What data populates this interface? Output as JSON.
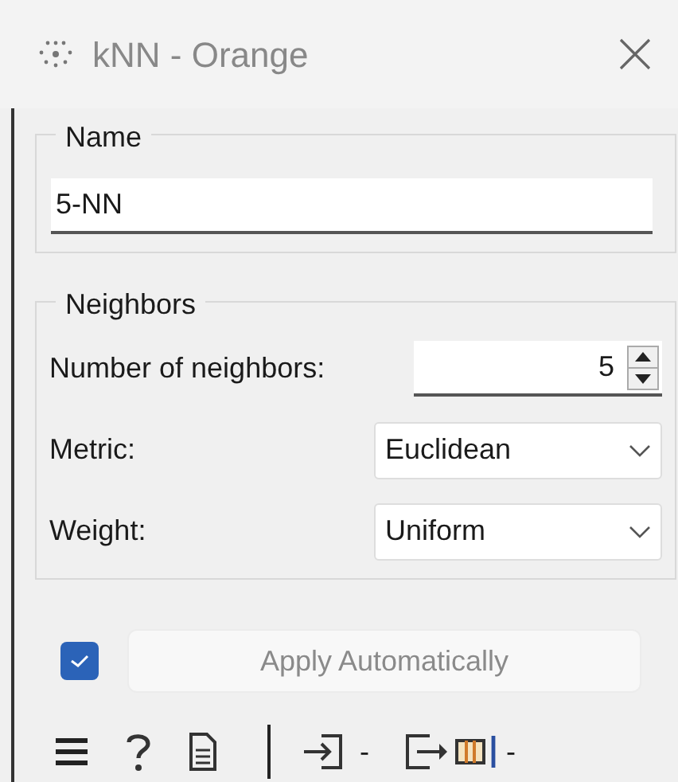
{
  "window": {
    "title": "kNN - Orange"
  },
  "name_box": {
    "title": "Name",
    "value": "5-NN"
  },
  "neighbors_box": {
    "title": "Neighbors",
    "fields": [
      {
        "kind": "spin",
        "label": "Number of neighbors:",
        "value": "5"
      },
      {
        "kind": "combo",
        "label": "Metric:",
        "value": "Euclidean"
      },
      {
        "kind": "combo",
        "label": "Weight:",
        "value": "Uniform"
      }
    ]
  },
  "auto_apply": {
    "checked": true,
    "label": "Apply Automatically",
    "disabled": true
  },
  "status_bar": {
    "input_count": "-",
    "output_count": "-"
  }
}
